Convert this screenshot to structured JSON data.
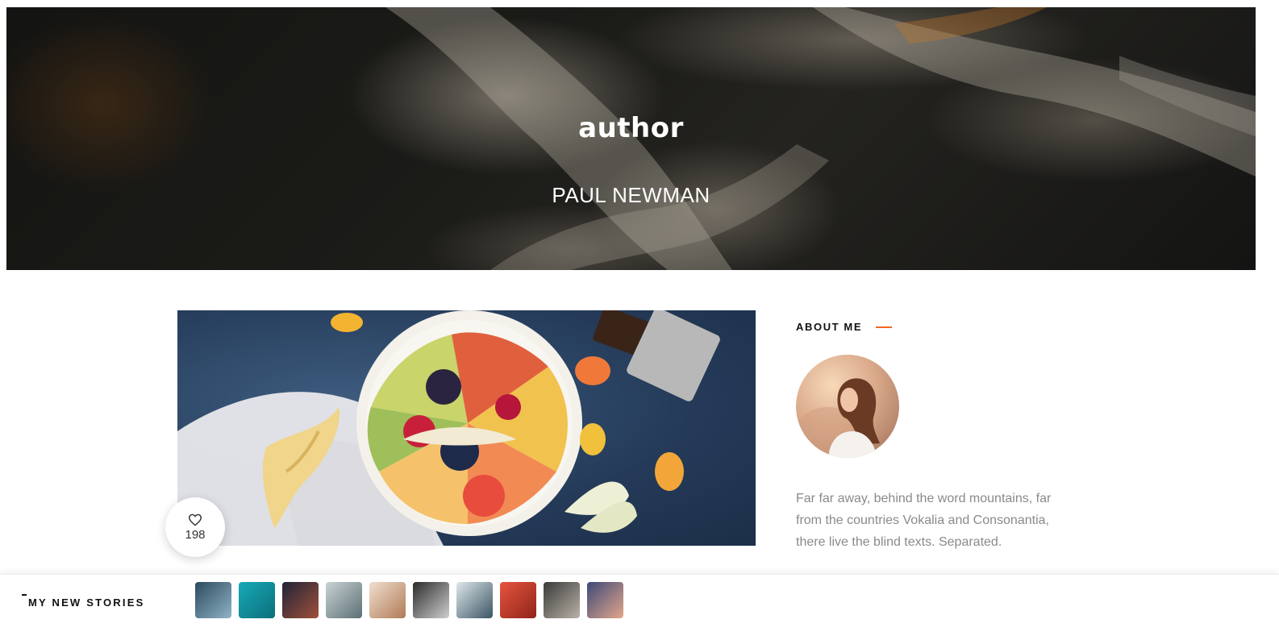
{
  "hero": {
    "title": "author",
    "name": "PAUL NEWMAN"
  },
  "post": {
    "likes_icon": "heart-icon",
    "likes": "198"
  },
  "sidebar": {
    "about_heading": "ABOUT ME",
    "about_text": "Far far away, behind the word mountains, far from the countries Vokalia and Consonantia, there live the blind texts. Separated.",
    "accent_color": "#f26522"
  },
  "stories": {
    "label": "MY NEW STORIES",
    "thumbnails": [
      {
        "name": "story-thumb-1",
        "colors": [
          "#2d4a5e",
          "#8fb3c6"
        ]
      },
      {
        "name": "story-thumb-2",
        "colors": [
          "#16a9b8",
          "#0d6f7a"
        ]
      },
      {
        "name": "story-thumb-3",
        "colors": [
          "#1f2438",
          "#a0503a"
        ]
      },
      {
        "name": "story-thumb-4",
        "colors": [
          "#c9d3d6",
          "#5c6f73"
        ]
      },
      {
        "name": "story-thumb-5",
        "colors": [
          "#f1dfcf",
          "#b07a55"
        ]
      },
      {
        "name": "story-thumb-6",
        "colors": [
          "#2b2b2b",
          "#cfcfcf"
        ]
      },
      {
        "name": "story-thumb-7",
        "colors": [
          "#dfe8ec",
          "#3b5563"
        ]
      },
      {
        "name": "story-thumb-8",
        "colors": [
          "#e6553f",
          "#8f2419"
        ]
      },
      {
        "name": "story-thumb-9",
        "colors": [
          "#3a3a3a",
          "#b9b2a6"
        ]
      },
      {
        "name": "story-thumb-10",
        "colors": [
          "#3c4a78",
          "#e4a58a"
        ]
      }
    ]
  }
}
